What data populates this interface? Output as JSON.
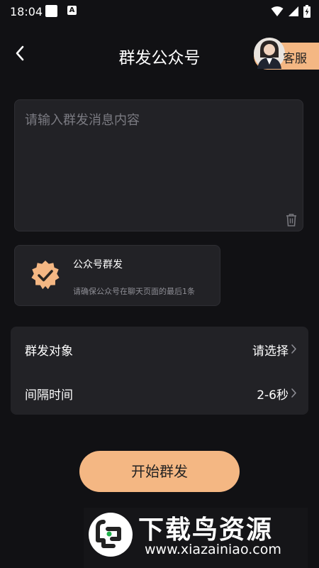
{
  "status_bar": {
    "time": "18:04",
    "a_icon": "A"
  },
  "header": {
    "title": "群发公众号",
    "back_icon": "chevron-left-icon",
    "customer_service_label": "客服"
  },
  "message": {
    "placeholder": "请输入群发消息内容",
    "value": ""
  },
  "mode_card": {
    "title": "公众号群发",
    "subtitle": "请确保公众号在聊天页面的最后1条"
  },
  "settings": [
    {
      "label": "群发对象",
      "value": "请选择"
    },
    {
      "label": "间隔时间",
      "value": "2-6秒"
    }
  ],
  "start_button": {
    "label": "开始群发"
  },
  "watermark": {
    "text": "下载鸟资源",
    "url": "www.xiazainiao.com"
  },
  "colors": {
    "background": "#111114",
    "panel": "#222226",
    "accent": "#f4b783"
  }
}
